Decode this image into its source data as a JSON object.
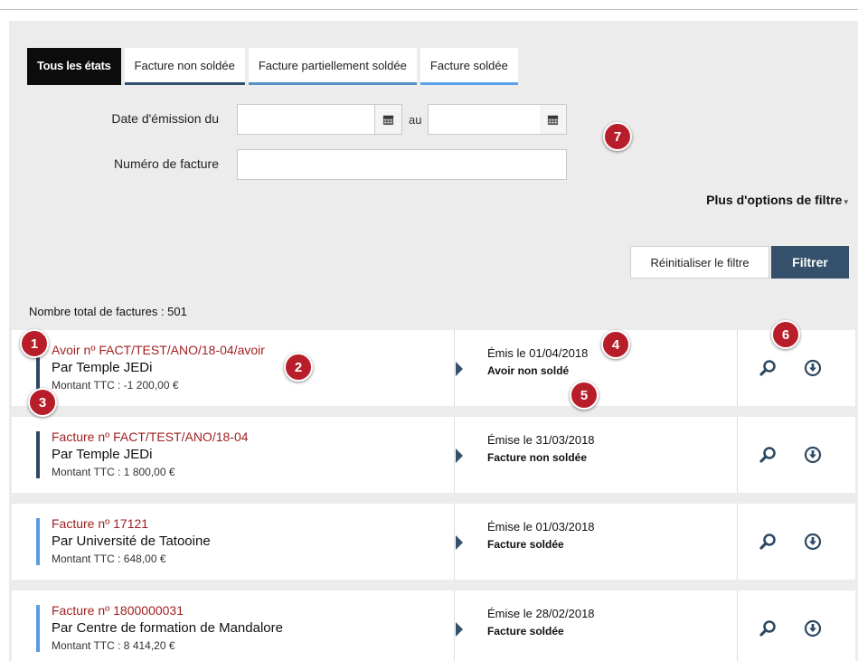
{
  "tabs": [
    {
      "label": "Tous les états",
      "active": true
    },
    {
      "label": "Facture non soldée",
      "active": false
    },
    {
      "label": "Facture partiellement soldée",
      "active": false
    },
    {
      "label": "Facture soldée",
      "active": false
    }
  ],
  "filters": {
    "date_label": "Date d'émission du",
    "date_from_value": "",
    "date_separator": "au",
    "date_to_value": "",
    "invoice_number_label": "Numéro de facture",
    "invoice_number_value": "",
    "more_options_label": "Plus d'options de filtre",
    "reset_label": "Réinitialiser le filtre",
    "filter_label": "Filtrer"
  },
  "total_label": "Nombre total de factures : 501",
  "invoices": [
    {
      "title": "Avoir nº FACT/TEST/ANO/18-04/avoir",
      "by": "Par Temple JEDi",
      "amount": "Montant TTC : -1 200,00 €",
      "date": "Émis le 01/04/2018",
      "state": "Avoir non soldé",
      "bar_color": "#2f4964"
    },
    {
      "title": "Facture nº FACT/TEST/ANO/18-04",
      "by": "Par Temple JEDi",
      "amount": "Montant TTC : 1 800,00 €",
      "date": "Émise le 31/03/2018",
      "state": "Facture non soldée",
      "bar_color": "#2f4964"
    },
    {
      "title": "Facture nº 17121",
      "by": "Par Université de Tatooine",
      "amount": "Montant TTC : 648,00 €",
      "date": "Émise le 01/03/2018",
      "state": "Facture soldée",
      "bar_color": "#5b9ce0"
    },
    {
      "title": "Facture nº 1800000031",
      "by": "Par Centre de formation de Mandalore",
      "amount": "Montant TTC : 8 414,20 €",
      "date": "Émise le 28/02/2018",
      "state": "Facture soldée",
      "bar_color": "#5b9ce0"
    }
  ],
  "badges": [
    "1",
    "2",
    "3",
    "4",
    "5",
    "6",
    "7"
  ],
  "icons": {
    "calendar": "calendar-icon",
    "view": "magnifier-icon",
    "download": "download-circle-icon",
    "expand": "triangle-right-icon"
  },
  "colors": {
    "accent_red": "#b81d2a",
    "title_red": "#9e1e1e",
    "primary_button": "#34506a"
  }
}
